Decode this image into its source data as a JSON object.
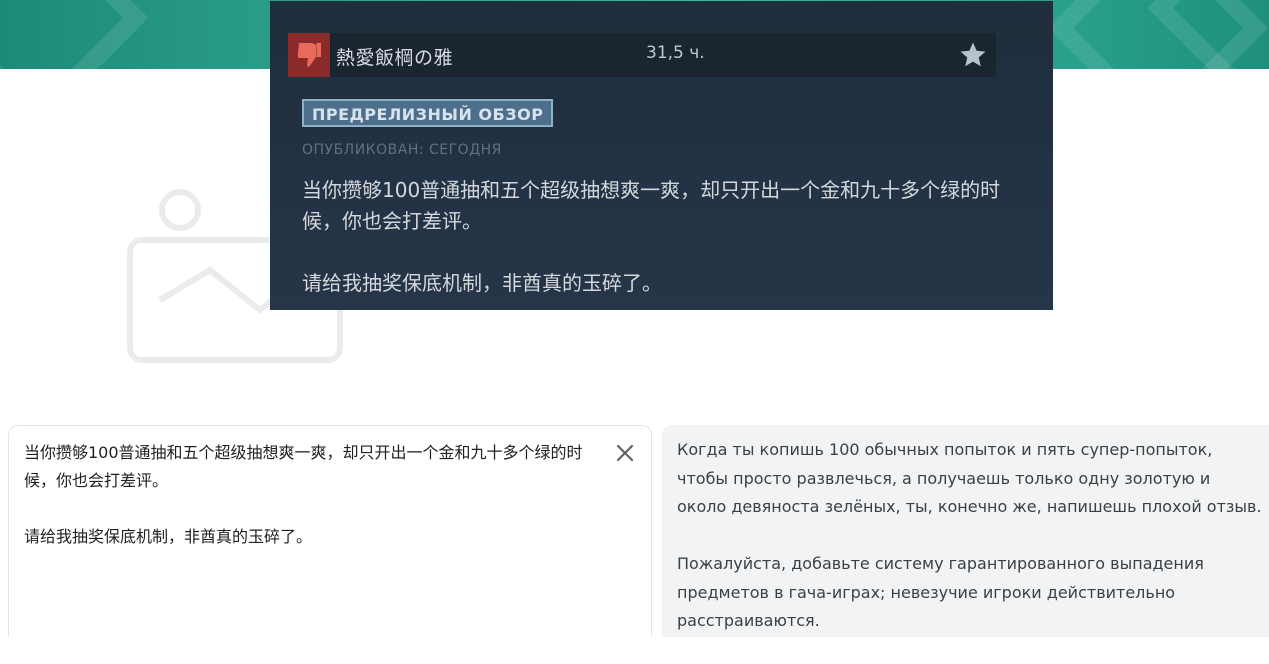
{
  "review": {
    "reviewer_name": "熱愛飯棡の雅",
    "hours": "31,5 ч.",
    "badge": "ПРЕДРЕЛИЗНЫЙ ОБЗОР",
    "published": "ОПУБЛИКОВАН: СЕГОДНЯ",
    "paragraphs": [
      "当你攒够100普通抽和五个超级抽想爽一爽，却只开出一个金和九十多个绿的时候，你也会打差评。",
      "请给我抽奖保底机制，非酋真的玉碎了。"
    ],
    "recommendation_icon": "thumbs-down-icon",
    "colors": {
      "card_bg": "#233244",
      "header_bg": "#1a2530",
      "thumb_bg": "#8a2a2a",
      "badge_bg": "#4e6f8c"
    }
  },
  "translator": {
    "source_paragraphs": [
      "当你攒够100普通抽和五个超级抽想爽一爽，却只开出一个金和九十多个绿的时候，你也会打差评。",
      "请给我抽奖保底机制，非酋真的玉碎了。"
    ],
    "target_paragraphs": [
      "Когда ты копишь 100 обычных попыток и пять супер-попыток, чтобы просто развлечься, а получаешь только одну золотую и около девяноста зелёных, ты, конечно же, напишешь плохой отзыв.",
      "Пожалуйста, добавьте систему гарантированного выпадения предметов в гача-играх; невезучие игроки действительно расстраиваются."
    ],
    "clear_icon": "close-icon"
  },
  "banner": {
    "color": "#2fa590"
  }
}
